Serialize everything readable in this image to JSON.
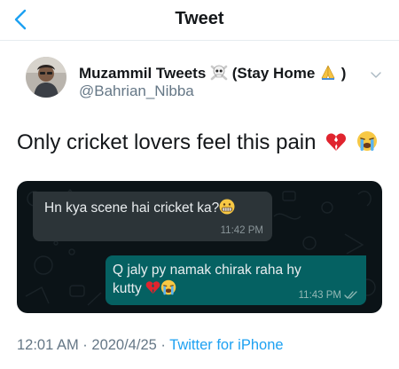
{
  "nav": {
    "title": "Tweet"
  },
  "author": {
    "name_prefix": "Muzammil Tweets",
    "name_mid": "(Stay Home",
    "name_suffix": ")",
    "handle": "@Bahrian_Nibba",
    "emoji_1": "skull-crossbones",
    "emoji_2": "folded-hands"
  },
  "tweet": {
    "text": "Only cricket lovers feel this pain",
    "emojis": [
      "broken-heart",
      "loudly-crying-face"
    ]
  },
  "chat": {
    "incoming": {
      "text": "Hn kya scene hai cricket ka?",
      "emoji": "grimacing-face",
      "time": "11:42 PM"
    },
    "outgoing": {
      "text": "Q jaly py namak chirak raha hy kutty",
      "emojis": [
        "broken-heart",
        "loudly-crying-face"
      ],
      "time": "11:43 PM",
      "status": "read-double-check"
    }
  },
  "meta": {
    "time": "12:01 AM",
    "separator": " · ",
    "date": "2020/4/25",
    "source": "Twitter for iPhone"
  },
  "colors": {
    "twitter_blue": "#1da1f2",
    "chat_bg": "#0b1317",
    "incoming_bubble": "#2c3438",
    "outgoing_bubble": "#056162"
  }
}
